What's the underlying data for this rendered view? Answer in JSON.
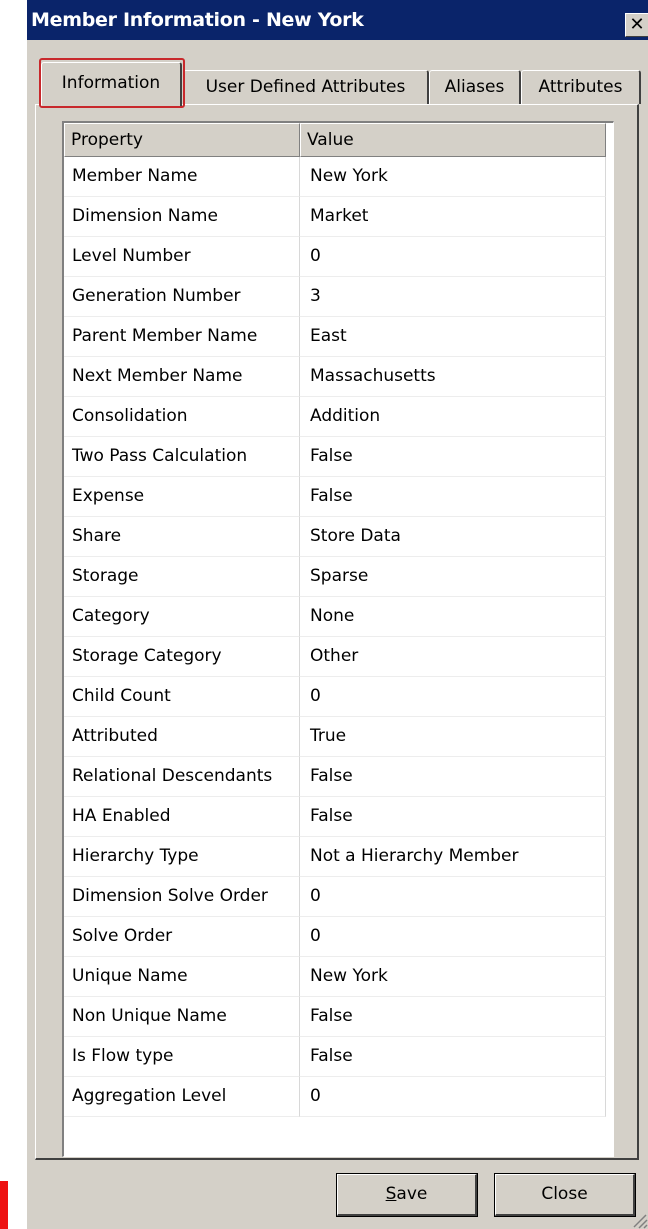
{
  "window": {
    "title": "Member Information - New York",
    "close_label": "✕"
  },
  "tabs": [
    {
      "label": "Information",
      "active": true
    },
    {
      "label": "User Defined Attributes",
      "active": false
    },
    {
      "label": "Aliases",
      "active": false
    },
    {
      "label": "Attributes",
      "active": false
    }
  ],
  "table": {
    "headers": [
      "Property",
      "Value"
    ],
    "rows": [
      [
        "Member Name",
        "New York"
      ],
      [
        "Dimension Name",
        "Market"
      ],
      [
        "Level Number",
        "0"
      ],
      [
        "Generation Number",
        "3"
      ],
      [
        "Parent Member Name",
        "East"
      ],
      [
        "Next Member Name",
        "Massachusetts"
      ],
      [
        "Consolidation",
        "Addition"
      ],
      [
        "Two Pass Calculation",
        "False"
      ],
      [
        "Expense",
        "False"
      ],
      [
        "Share",
        "Store Data"
      ],
      [
        "Storage",
        "Sparse"
      ],
      [
        "Category",
        "None"
      ],
      [
        "Storage Category",
        "Other"
      ],
      [
        "Child Count",
        "0"
      ],
      [
        "Attributed",
        "True"
      ],
      [
        "Relational Descendants",
        "False"
      ],
      [
        "HA Enabled",
        "False"
      ],
      [
        "Hierarchy Type",
        "Not a Hierarchy Member"
      ],
      [
        "Dimension Solve Order",
        "0"
      ],
      [
        "Solve Order",
        "0"
      ],
      [
        "Unique Name",
        "New York"
      ],
      [
        "Non Unique Name",
        "False"
      ],
      [
        "Is Flow type",
        "False"
      ],
      [
        "Aggregation Level",
        "0"
      ]
    ]
  },
  "buttons": {
    "save_mnemonic": "S",
    "save_rest": "ave",
    "close": "Close"
  },
  "colors": {
    "titlebar": "#0a246a",
    "highlight": "#c8282c",
    "face": "#d4d0c8"
  },
  "icons": {
    "close": "close-icon",
    "grip": "resize-grip-icon"
  }
}
